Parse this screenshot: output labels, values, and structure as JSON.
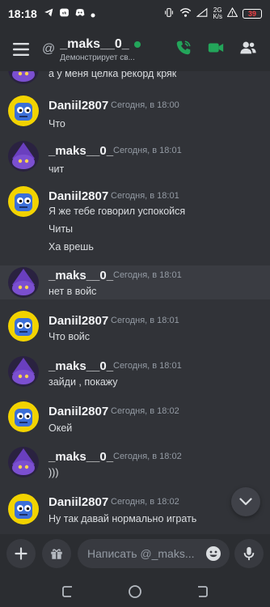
{
  "status_bar": {
    "time": "18:18",
    "net_label_top": "2G",
    "net_label_bottom": "K/s",
    "battery": "39"
  },
  "header": {
    "dm_username": "_maks__0_",
    "status_text": "Демонстрирует св...",
    "online_color": "#23a55a",
    "action_icons": [
      "voice-call-icon",
      "video-call-icon",
      "members-icon"
    ]
  },
  "messages": [
    {
      "author": "",
      "timestamp": "",
      "lines": [
        "а у меня целка рекорд кряк"
      ],
      "avatar": "wizard"
    },
    {
      "author": "Daniil2807",
      "timestamp": "Сегодня, в 18:00",
      "lines": [
        "Что"
      ],
      "avatar": "blue"
    },
    {
      "author": "_maks__0_",
      "timestamp": "Сегодня, в 18:01",
      "lines": [
        "чит"
      ],
      "avatar": "wizard"
    },
    {
      "author": "Daniil2807",
      "timestamp": "Сегодня, в 18:01",
      "lines": [
        "Я же тебе говорил успокойся",
        "Читы",
        "Ха врешь"
      ],
      "avatar": "blue"
    },
    {
      "author": "_maks__0_",
      "timestamp": "Сегодня, в 18:01",
      "lines": [
        "нет в войс"
      ],
      "avatar": "wizard",
      "highlighted": true
    },
    {
      "author": "Daniil2807",
      "timestamp": "Сегодня, в 18:01",
      "lines": [
        "Что войс"
      ],
      "avatar": "blue"
    },
    {
      "author": "_maks__0_",
      "timestamp": "Сегодня, в 18:01",
      "lines": [
        "зайди , покажу"
      ],
      "avatar": "wizard"
    },
    {
      "author": "Daniil2807",
      "timestamp": "Сегодня, в 18:02",
      "lines": [
        "Окей"
      ],
      "avatar": "blue"
    },
    {
      "author": "_maks__0_",
      "timestamp": "Сегодня, в 18:02",
      "lines": [
        ")))"
      ],
      "avatar": "wizard"
    },
    {
      "author": "Daniil2807",
      "timestamp": "Сегодня, в 18:02",
      "lines": [
        "Ну  так давай нормально играть"
      ],
      "avatar": "blue"
    }
  ],
  "composer": {
    "placeholder": "Написать @_maks...",
    "buttons": [
      "plus-icon",
      "gift-icon",
      "emoji-icon",
      "microphone-icon"
    ]
  },
  "colors": {
    "background": "#313338",
    "header": "#2b2d31",
    "accent_green": "#23a55a",
    "highlight": "#3a3c42"
  }
}
